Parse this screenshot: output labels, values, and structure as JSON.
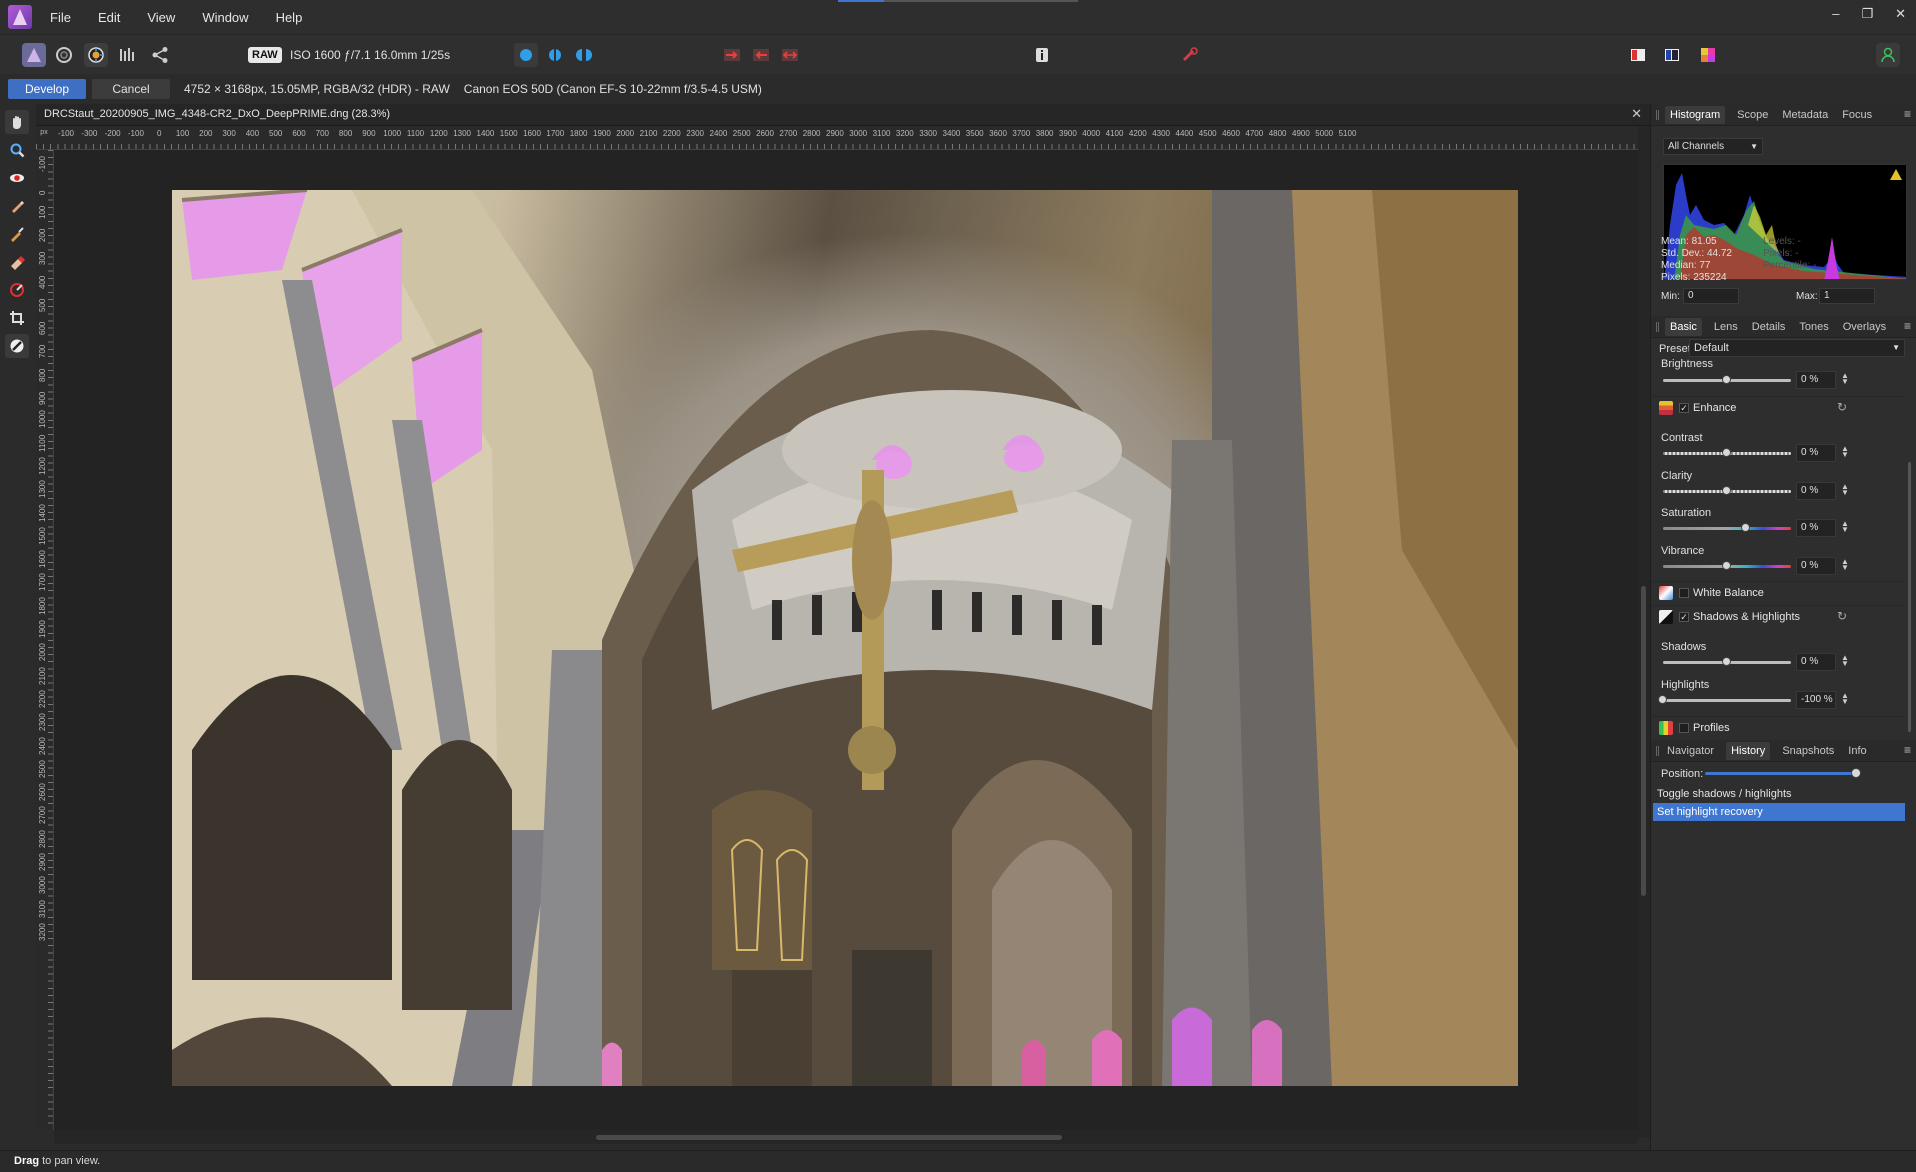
{
  "menu": [
    "File",
    "Edit",
    "View",
    "Window",
    "Help"
  ],
  "window_controls": [
    "–",
    "❐",
    "✕"
  ],
  "toolbar": {
    "raw_badge": "RAW",
    "exif": "ISO 1600 ƒ/7.1 16.0mm 1/25s"
  },
  "context": {
    "develop_label": "Develop",
    "cancel_label": "Cancel",
    "image_info": "4752 × 3168px, 15.05MP, RGBA/32 (HDR) - RAW",
    "camera_info": "Canon EOS 50D (Canon EF-S 10-22mm f/3.5-4.5 USM)"
  },
  "document": {
    "title": "DRCStaut_20200905_IMG_4348-CR2_DxO_DeepPRIME.dng (28.3%)",
    "close": "✕",
    "ruler_unit": "px",
    "hruler_ticks": [
      "-100",
      "-300",
      "-200",
      "-100",
      "0",
      "100",
      "200",
      "300",
      "400",
      "500",
      "600",
      "700",
      "800",
      "900",
      "1000",
      "1100",
      "1200",
      "1300",
      "1400",
      "1500",
      "1600",
      "1700",
      "1800",
      "1900",
      "2000",
      "2100",
      "2200",
      "2300",
      "2400",
      "2500",
      "2600",
      "2700",
      "2800",
      "2900",
      "3000",
      "3100",
      "3200",
      "3300",
      "3400",
      "3500",
      "3600",
      "3700",
      "3800",
      "3900",
      "4000",
      "4100",
      "4200",
      "4300",
      "4400",
      "4500",
      "4600",
      "4700",
      "4800",
      "4900",
      "5000",
      "5100"
    ],
    "vruler_ticks": [
      "-100",
      "0",
      "100",
      "200",
      "300",
      "400",
      "500",
      "600",
      "700",
      "800",
      "900",
      "1000",
      "1100",
      "1200",
      "1300",
      "1400",
      "1500",
      "1600",
      "1700",
      "1800",
      "1900",
      "2000",
      "2100",
      "2200",
      "2300",
      "2400",
      "2500",
      "2600",
      "2700",
      "2800",
      "2900",
      "3000",
      "3100",
      "3200"
    ]
  },
  "histogram_panel": {
    "tabs": [
      "Histogram",
      "Scope",
      "Metadata",
      "Focus"
    ],
    "channels": "All Channels",
    "stats": {
      "mean": "Mean: 81.05",
      "std_dev": "Std. Dev.: 44.72",
      "median": "Median: 77",
      "pixels": "Pixels: 235224"
    },
    "dim_stats": [
      "Levels: -",
      "Pixels: -",
      "Percentile: -"
    ],
    "min_label": "Min:",
    "min_value": "0",
    "max_label": "Max:",
    "max_value": "1"
  },
  "develop_panel": {
    "tabs": [
      "Basic",
      "Lens",
      "Details",
      "Tones",
      "Overlays"
    ],
    "preset_label": "Preset:",
    "preset_value": "Default",
    "brightness": {
      "label": "Brightness",
      "value": "0 %",
      "level": 0.5
    },
    "enhance": {
      "label": "Enhance",
      "checked": "✓"
    },
    "contrast": {
      "label": "Contrast",
      "value": "0 %",
      "level": 0.5
    },
    "clarity": {
      "label": "Clarity",
      "value": "0 %",
      "level": 0.5
    },
    "saturation": {
      "label": "Saturation",
      "value": "0 %",
      "level": 0.65
    },
    "vibrance": {
      "label": "Vibrance",
      "value": "0 %",
      "level": 0.5
    },
    "white_balance": {
      "label": "White Balance"
    },
    "shadows_highlights": {
      "label": "Shadows & Highlights",
      "checked": "✓"
    },
    "shadows": {
      "label": "Shadows",
      "value": "0 %",
      "level": 0.5
    },
    "highlights": {
      "label": "Highlights",
      "value": "-100 %",
      "level": 0.0
    },
    "profiles": {
      "label": "Profiles"
    }
  },
  "history_panel": {
    "tabs": [
      "Navigator",
      "History",
      "Snapshots",
      "Info"
    ],
    "position_label": "Position:",
    "items": [
      "Toggle shadows / highlights",
      "Set highlight recovery"
    ]
  },
  "status": {
    "bold": "Drag",
    "rest": " to pan view."
  }
}
